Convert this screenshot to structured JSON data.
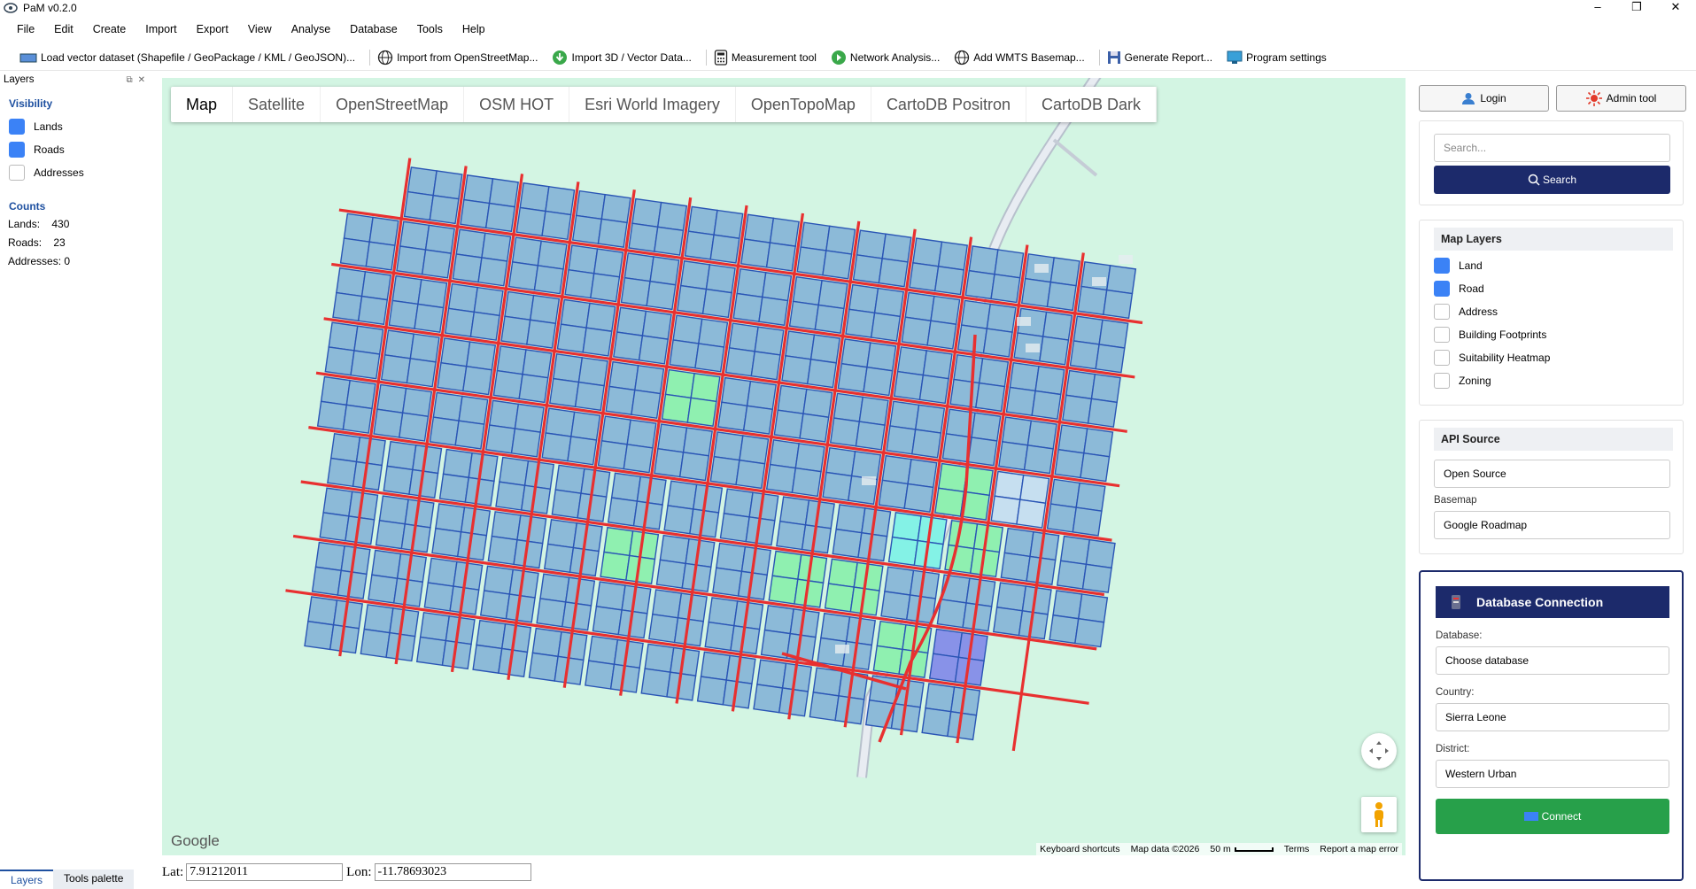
{
  "app": {
    "title": "PaM v0.2.0"
  },
  "menu": [
    "File",
    "Edit",
    "Create",
    "Import",
    "Export",
    "View",
    "Analyse",
    "Database",
    "Tools",
    "Help"
  ],
  "toolbar": {
    "load_vector": "Load vector dataset (Shapefile / GeoPackage / KML / GeoJSON)...",
    "import_osm": "Import from OpenStreetMap...",
    "import_3d": "Import 3D / Vector Data...",
    "measurement": "Measurement tool",
    "network": "Network Analysis...",
    "wmts": "Add WMTS Basemap...",
    "report": "Generate Report...",
    "settings": "Program settings"
  },
  "layers_panel": {
    "title": "Layers",
    "visibility_heading": "Visibility",
    "items": [
      {
        "label": "Lands",
        "checked": true
      },
      {
        "label": "Roads",
        "checked": true
      },
      {
        "label": "Addresses",
        "checked": false
      }
    ],
    "counts_heading": "Counts",
    "counts": [
      {
        "label": "Lands:",
        "value": "430"
      },
      {
        "label": "Roads:",
        "value": "23"
      },
      {
        "label": "Addresses:",
        "value": "0"
      }
    ]
  },
  "bottom_tabs": {
    "layers": "Layers",
    "tools": "Tools palette"
  },
  "map": {
    "types": [
      "Map",
      "Satellite",
      "OpenStreetMap",
      "OSM HOT",
      "Esri World Imagery",
      "OpenTopoMap",
      "CartoDB Positron",
      "CartoDB Dark"
    ],
    "active_type": "Map",
    "google": "Google",
    "attribution": {
      "shortcuts": "Keyboard shortcuts",
      "data": "Map data ©2026",
      "scale": "50 m",
      "terms": "Terms",
      "report": "Report a map error"
    },
    "colors": {
      "background": "#d3f5e3",
      "parcel": "#8cbad8",
      "parcel_stroke": "#2a55b5",
      "road": "#e83030",
      "green": "#8ff0b0",
      "cyan": "#84f2e6"
    }
  },
  "coords": {
    "lat_label": "Lat:",
    "lat": "7.91212011",
    "lon_label": "Lon:",
    "lon": "-11.78693023"
  },
  "right": {
    "login": "Login",
    "admin": "Admin tool",
    "search_placeholder": "Search...",
    "search_button": "Search",
    "map_layers_heading": "Map Layers",
    "map_layers": [
      {
        "label": "Land",
        "checked": true
      },
      {
        "label": "Road",
        "checked": true
      },
      {
        "label": "Address",
        "checked": false
      },
      {
        "label": "Building Footprints",
        "checked": false
      },
      {
        "label": "Suitability Heatmap",
        "checked": false
      },
      {
        "label": "Zoning",
        "checked": false
      }
    ],
    "api_heading": "API Source",
    "api_value": "Open Source",
    "basemap_label": "Basemap",
    "basemap_value": "Google Roadmap",
    "db": {
      "title": "Database Connection",
      "database_label": "Database:",
      "database_value": "Choose database",
      "country_label": "Country:",
      "country_value": "Sierra Leone",
      "district_label": "District:",
      "district_value": "Western Urban",
      "connect": "Connect"
    }
  }
}
